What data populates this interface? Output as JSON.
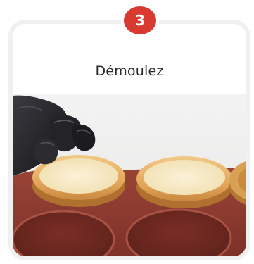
{
  "step": {
    "number": "3",
    "title": "Démoulez"
  },
  "photo": {
    "icon": "tart-shells-demolding-photo"
  },
  "colors": {
    "badge": "#d93a30",
    "card_border": "#f0f0f0",
    "mold": "#8e3b30",
    "pastry": "#e8b46d",
    "glove": "#1e1e22"
  }
}
